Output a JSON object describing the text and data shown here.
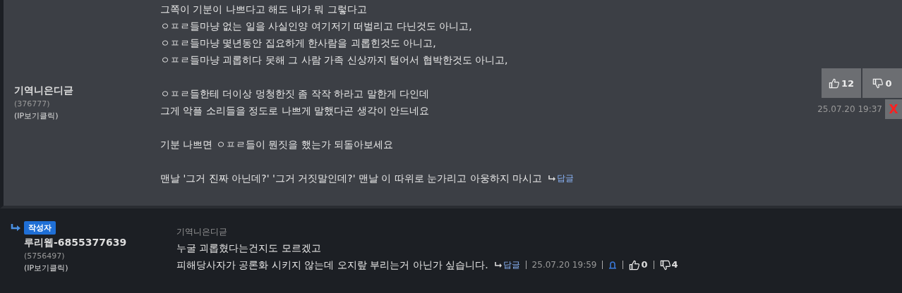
{
  "comments": [
    {
      "author": "기역니은디귿",
      "user_id": "(376777)",
      "ip_link": "(IP보기클릭)",
      "kind": "comment",
      "paragraphs": [
        [
          "그쪽이 기분이 나쁘다고 해도 내가 뭐 그렇다고",
          "ㅇㅍㄹ들마냥 없는 일을 사실인양 여기저기 떠벌리고 다닌것도 아니고,",
          "ㅇㅍㄹ들마냥 몇년동안 집요하게 한사람을 괴롭힌것도 아니고,",
          "ㅇㅍㄹ들마냥 괴롭히다 못해 그 사람 가족 신상까지 털어서 협박한것도 아니고,"
        ],
        [
          "ㅇㅍㄹ들한테 더이상  멍청한짓 좀 작작 하라고 말한게 다인데",
          "그게 악플 소리들을 정도로 나쁘게 말했다곤 생각이 안드네요"
        ],
        [
          "기분 나쁘면 ㅇㅍㄹ들이 뭔짓을 했는가 되돌아보세요"
        ],
        [
          "맨날 '그거 진짜 아닌데?' '그거 거짓말인데?' 맨날 이 따위로 눈가리고 아웅하지 마시고"
        ]
      ],
      "reply_label": "답글",
      "likes": "12",
      "dislikes": "0",
      "date": "25.07.20 19:37",
      "delete_label": "X"
    },
    {
      "author": "루리웹-6855377639",
      "badge": "작성자",
      "user_id": "(5756497)",
      "ip_link": "(IP보기클릭)",
      "kind": "reply",
      "reply_to": "기역니은디귿",
      "paragraphs": [
        [
          "누굴 괴롭혔다는건지도 모르겠고",
          "피해당사자가 공론화 시키지 않는데 오지랖 부리는거 아닌가 싶습니다."
        ]
      ],
      "reply_label": "답글",
      "likes": "0",
      "dislikes": "4",
      "date": "25.07.20 19:59"
    }
  ]
}
